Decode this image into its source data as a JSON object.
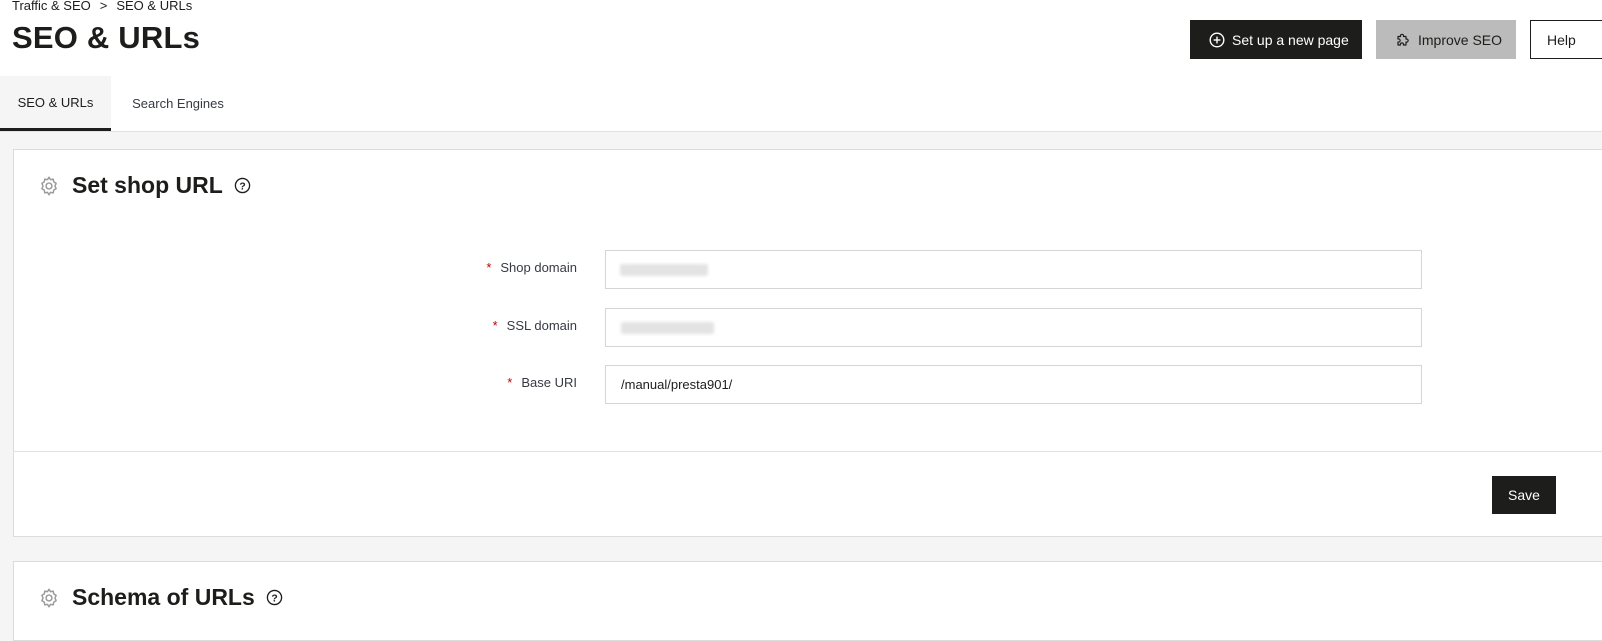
{
  "breadcrumb": {
    "parent": "Traffic & SEO",
    "separator": ">",
    "current": "SEO & URLs"
  },
  "page": {
    "title": "SEO & URLs"
  },
  "toolbar": {
    "new_page_label": "Set up a new page",
    "improve_seo_label": "Improve SEO",
    "help_label": "Help"
  },
  "tabs": [
    {
      "label": "SEO & URLs",
      "active": true
    },
    {
      "label": "Search Engines",
      "active": false
    }
  ],
  "shop_url_panel": {
    "title": "Set shop URL",
    "fields": [
      {
        "label": "Shop domain",
        "required_mark": "*",
        "value": ""
      },
      {
        "label": "SSL domain",
        "required_mark": "*",
        "value": ""
      },
      {
        "label": "Base URI",
        "required_mark": "*",
        "value": "/manual/presta901/"
      }
    ],
    "save_label": "Save"
  },
  "schema_panel": {
    "title": "Schema of URLs"
  },
  "colors": {
    "primary": "#1d1d1b",
    "required": "#c40000",
    "disabled_button": "#bbbbbb"
  }
}
